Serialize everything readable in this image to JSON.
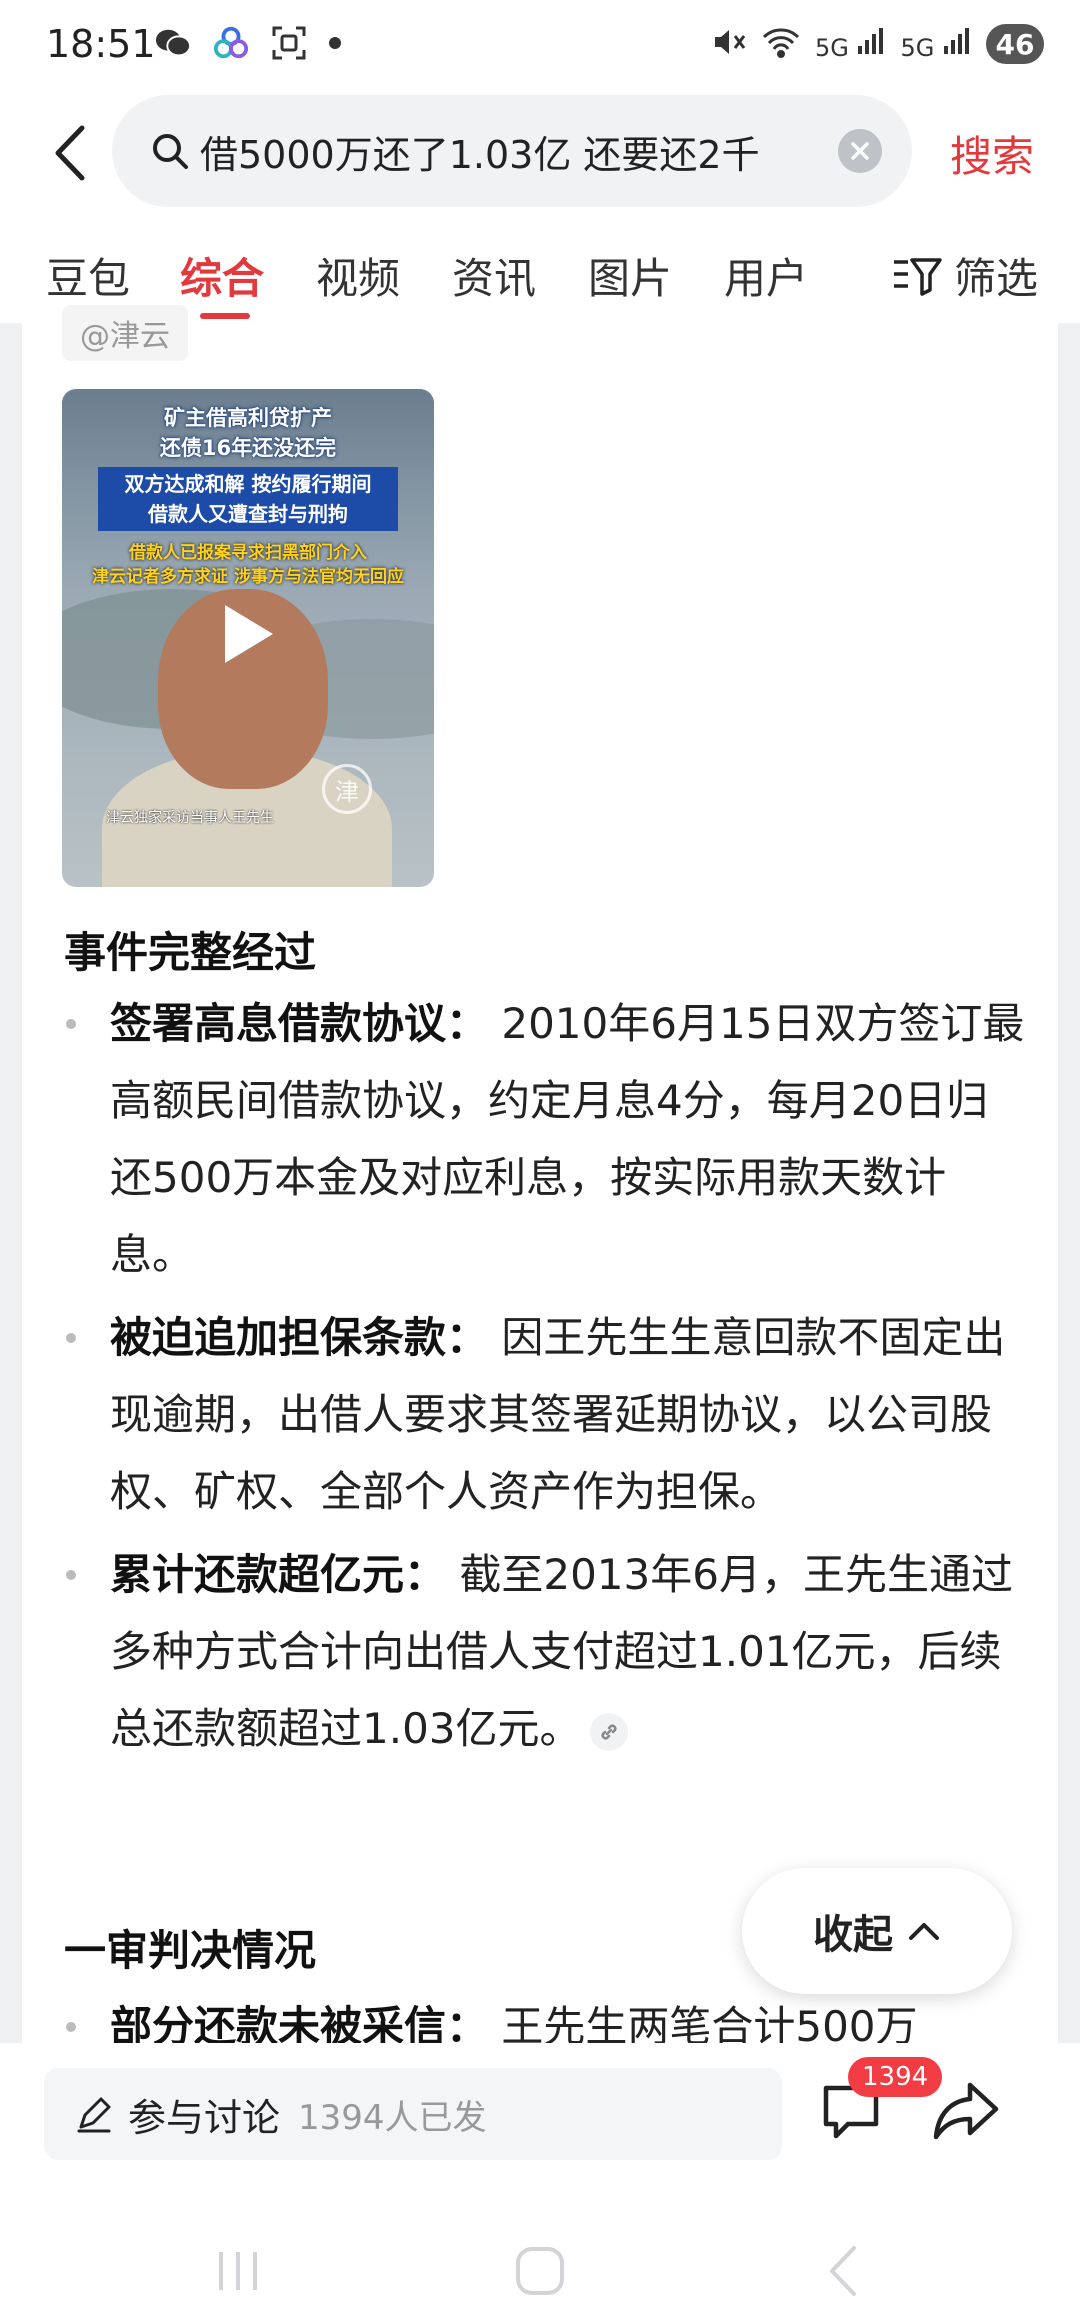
{
  "status": {
    "time": "18:51",
    "network_1": "5G",
    "network_2": "5G",
    "battery": "46"
  },
  "search": {
    "query": "借5000万还了1.03亿 还要还2千",
    "action_label": "搜索"
  },
  "tabs": [
    "豆包",
    "综合",
    "视频",
    "资讯",
    "图片",
    "用户"
  ],
  "active_tab": "综合",
  "filter_label": "筛选",
  "source_tag": "@津云",
  "video": {
    "caption_line1": "矿主借高利贷扩产",
    "caption_line2": "还债16年还没还完",
    "box_line1": "双方达成和解 按约履行期间",
    "box_line2": "借款人又遭查封与刑拘",
    "yellow_line1": "借款人已报案寻求扫黑部门介入",
    "yellow_line2": "津云记者多方求证 涉事方与法官均无回应",
    "interview_caption": "津云独家采访当事人王先生"
  },
  "sections": [
    {
      "title": "事件完整经过",
      "items": [
        {
          "label": "签署高息借款协议：",
          "text": " 2010年6月15日双方签订最高额民间借款协议，约定月息4分，每月20日归还500万本金及对应利息，按实际用款天数计息。"
        },
        {
          "label": "被迫追加担保条款：",
          "text": " 因王先生生意回款不固定出现逾期，出借人要求其签署延期协议，以公司股权、矿权、全部个人资产作为担保。"
        },
        {
          "label": "累计还款超亿元：",
          "text": " 截至2013年6月，王先生通过多种方式合计向出借人支付超过1.01亿元，后续总还款额超过1.03亿元。"
        }
      ]
    },
    {
      "title": "一审判决情况",
      "items": [
        {
          "label": "部分还款未被采信：",
          "text": " 王先生两笔合计500万"
        }
      ]
    }
  ],
  "collapse_label": "收起",
  "bottom": {
    "comment_label": "参与讨论",
    "comment_count": "1394人已发",
    "message_badge": "1394"
  }
}
